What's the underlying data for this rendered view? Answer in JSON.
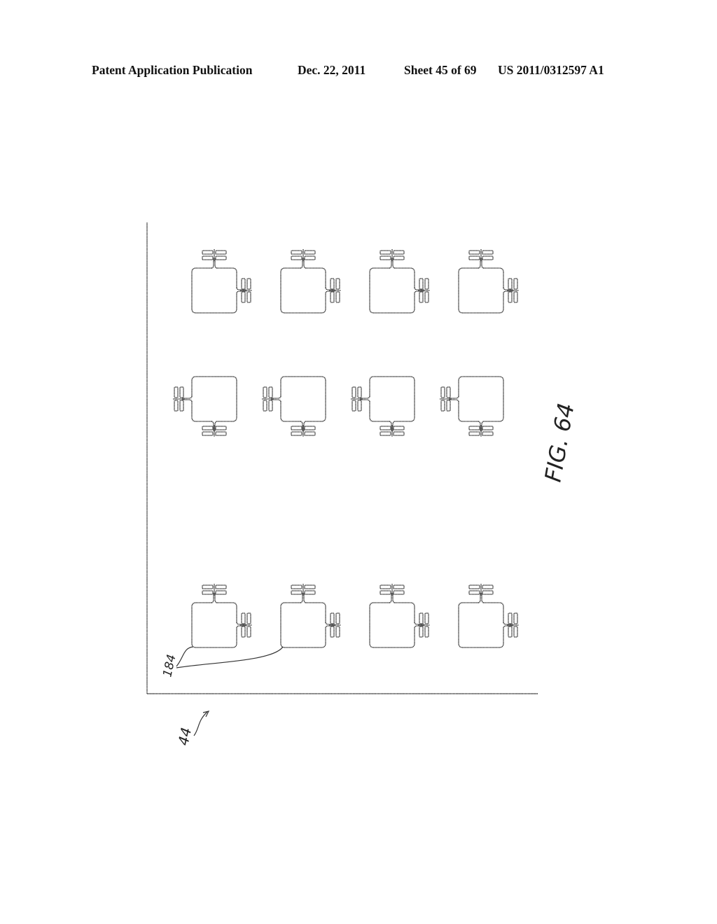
{
  "header": {
    "publication": "Patent Application Publication",
    "date": "Dec. 22, 2011",
    "sheet": "Sheet 45 of 69",
    "number": "US 2011/0312597 A1"
  },
  "figure": {
    "title": "FIG. 64",
    "reference_labels": {
      "sensors": "184",
      "substrate": "44"
    },
    "grid": {
      "columns": 4,
      "rows": [
        {
          "orientation": "tabs-top-right"
        },
        {
          "orientation": "tabs-left-bottom"
        },
        {
          "orientation": "tabs-top-right"
        }
      ]
    }
  }
}
